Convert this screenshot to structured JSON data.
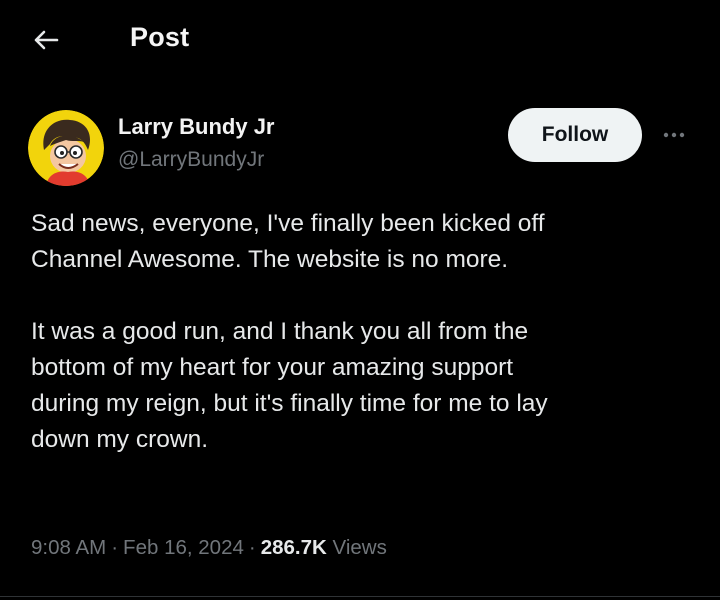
{
  "header": {
    "back_icon": "arrow-left-icon",
    "title": "Post"
  },
  "author": {
    "name": "Larry Bundy Jr",
    "handle": "@LarryBundyJr",
    "avatar_bg": "#f2d40c",
    "follow_label": "Follow",
    "more_icon": "more-horizontal-icon"
  },
  "tweet": {
    "paragraph1": "Sad news, everyone,  I've finally been kicked off\nChannel Awesome.  The website is no more.",
    "paragraph2": "It was a good run, and I thank you all from the\nbottom of my heart for your amazing support\nduring my reign, but it's finally time for me to lay\ndown my crown."
  },
  "meta": {
    "time": "9:08 AM",
    "separator": "·",
    "date": "Feb 16, 2024",
    "views_count": "286.7K",
    "views_label": "Views"
  },
  "colors": {
    "background": "#000000",
    "text": "#e7e9ea",
    "secondary_text": "#71767b",
    "follow_button_bg": "#eff3f4"
  }
}
